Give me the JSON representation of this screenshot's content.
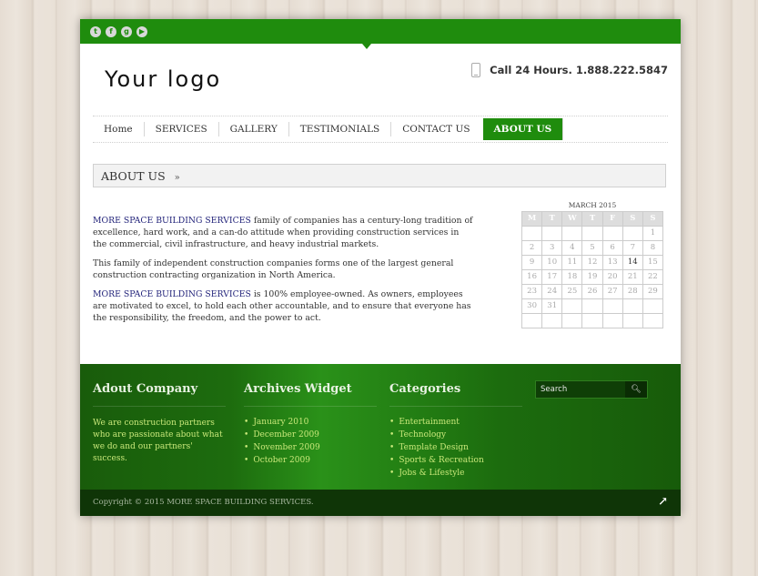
{
  "social": {
    "icons": [
      "twitter-icon",
      "facebook-icon",
      "google-plus-icon",
      "youtube-icon"
    ],
    "glyphs": [
      "t",
      "f",
      "g",
      "▶"
    ]
  },
  "header": {
    "logo_text": "Your logo",
    "phone_text": "Call 24 Hours. 1.888.222.5847"
  },
  "nav": {
    "items": [
      {
        "label": "Home"
      },
      {
        "label": "SERVICES"
      },
      {
        "label": "GALLERY"
      },
      {
        "label": "TESTIMONIALS"
      },
      {
        "label": "CONTACT US"
      },
      {
        "label": "ABOUT US",
        "active": true
      }
    ]
  },
  "breadcrumb": {
    "title": "ABOUT US",
    "separator": "»"
  },
  "content": {
    "p1_highlight": "MORE SPACE BUILDING SERVICES",
    "p1_text": " family of companies has a century-long tradition of excellence, hard work, and a can-do attitude when providing construction services in the commercial, civil infrastructure, and heavy industrial markets.",
    "p2_text": "This family of independent construction companies forms one of the largest general construction contracting organization in North America.",
    "p3_highlight": "MORE SPACE BUILDING SERVICES",
    "p3_text": " is 100% employee-owned. As owners, employees are motivated to excel, to hold each other accountable, and to ensure that everyone has the responsibility, the freedom, and the power to act."
  },
  "calendar": {
    "caption": "MARCH 2015",
    "weekdays": [
      "M",
      "T",
      "W",
      "T",
      "F",
      "S",
      "S"
    ],
    "cells": [
      "",
      "",
      "",
      "",
      "",
      "",
      "1",
      "2",
      "3",
      "4",
      "5",
      "6",
      "7",
      "8",
      "9",
      "10",
      "11",
      "12",
      "13",
      "14",
      "15",
      "16",
      "17",
      "18",
      "19",
      "20",
      "21",
      "22",
      "23",
      "24",
      "25",
      "26",
      "27",
      "28",
      "29",
      "30",
      "31",
      "",
      "",
      "",
      "",
      "",
      "",
      "",
      "",
      "",
      "",
      "",
      ""
    ],
    "today": "14"
  },
  "footer": {
    "about": {
      "title": "Adout Company",
      "text": "We are construction partners who are passionate about what we do and our partners' success."
    },
    "archives": {
      "title": "Archives Widget",
      "items": [
        "January 2010",
        "December 2009",
        "November 2009",
        "October 2009"
      ]
    },
    "categories": {
      "title": "Categories",
      "items": [
        "Entertainment",
        "Technology",
        "Template Design",
        "Sports & Recreation",
        "Jobs & Lifestyle"
      ]
    },
    "search_placeholder": "Search",
    "copyright": "Copyright © 2015 MORE SPACE BUILDING SERVICES."
  },
  "colors": {
    "brand_green": "#1f8c0d",
    "footer_link": "#c9e87a",
    "highlight_text": "#22237a"
  }
}
